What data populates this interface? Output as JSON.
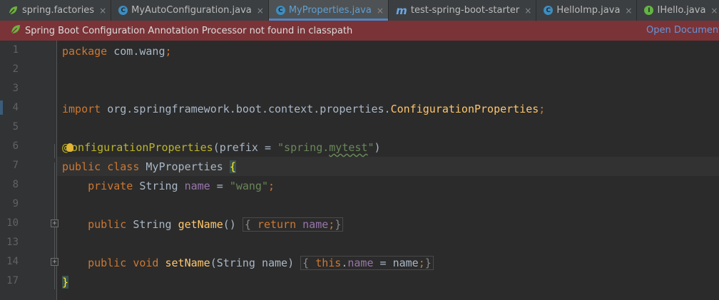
{
  "tabs": [
    {
      "label": "spring.factories",
      "icon": "spring-leaf-icon",
      "active": false
    },
    {
      "label": "MyAutoConfiguration.java",
      "icon": "class-icon",
      "icon_glyph": "C",
      "active": false
    },
    {
      "label": "MyProperties.java",
      "icon": "class-icon",
      "icon_glyph": "C",
      "active": true
    },
    {
      "label": "test-spring-boot-starter",
      "icon": "maven-icon",
      "icon_glyph": "m",
      "active": false
    },
    {
      "label": "HelloImp.java",
      "icon": "class-icon",
      "icon_glyph": "C",
      "active": false
    },
    {
      "label": "IHello.java",
      "icon": "interface-icon",
      "icon_glyph": "I",
      "active": false
    }
  ],
  "tab_close_glyph": "×",
  "warning": {
    "message": "Spring Boot Configuration Annotation Processor not found in classpath",
    "link": "Open Documentation..."
  },
  "line_numbers": [
    "1",
    "2",
    "3",
    "4",
    "5",
    "6",
    "7",
    "8",
    "9",
    "10",
    "13",
    "14",
    "17"
  ],
  "code": {
    "l1_kw": "package",
    "l1_rest": " com.wang",
    "l1_semi": ";",
    "l4_kw": "import",
    "l4_pkg": " org.springframework.boot.context.properties.",
    "l4_cls": "ConfigurationProperties",
    "l4_semi": ";",
    "l6_at": "@",
    "l6_ann": "onfigurationProperties",
    "l6_open": "(prefix = ",
    "l6_str1": "\"spring.",
    "l6_str2": "mytest",
    "l6_str3": "\"",
    "l6_close": ")",
    "l7_kw": "public class",
    "l7_name": " MyProperties ",
    "l7_brace": "{",
    "l8_indent": "    ",
    "l8_kw": "private",
    "l8_type": " String ",
    "l8_field": "name",
    "l8_eq": " = ",
    "l8_str": "\"wang\"",
    "l8_semi": ";",
    "l10_indent": "    ",
    "l10_kw": "public",
    "l10_type": " String ",
    "l10_fn": "getName",
    "l10_paren": "() ",
    "l10_ob": "{",
    "l10_kw2": " return ",
    "l10_field": "name",
    "l10_semi": ";",
    "l10_cb": "}",
    "l14_indent": "    ",
    "l14_kw": "public void",
    "l14_fn": " setName",
    "l14_params": "(String name) ",
    "l14_ob": "{",
    "l14_this": " this",
    "l14_dot": ".",
    "l14_field": "name",
    "l14_assign": " = name",
    "l14_semi": ";",
    "l14_cb": "}",
    "l17_brace": "}"
  },
  "fold_glyph": "+",
  "colors": {
    "keyword": "#cc7832",
    "annotation": "#bbb529",
    "string": "#6a8759",
    "field": "#9876aa",
    "method": "#ffc66d",
    "warning_bg": "#7a3337",
    "active_tab": "#5f9fd4"
  }
}
